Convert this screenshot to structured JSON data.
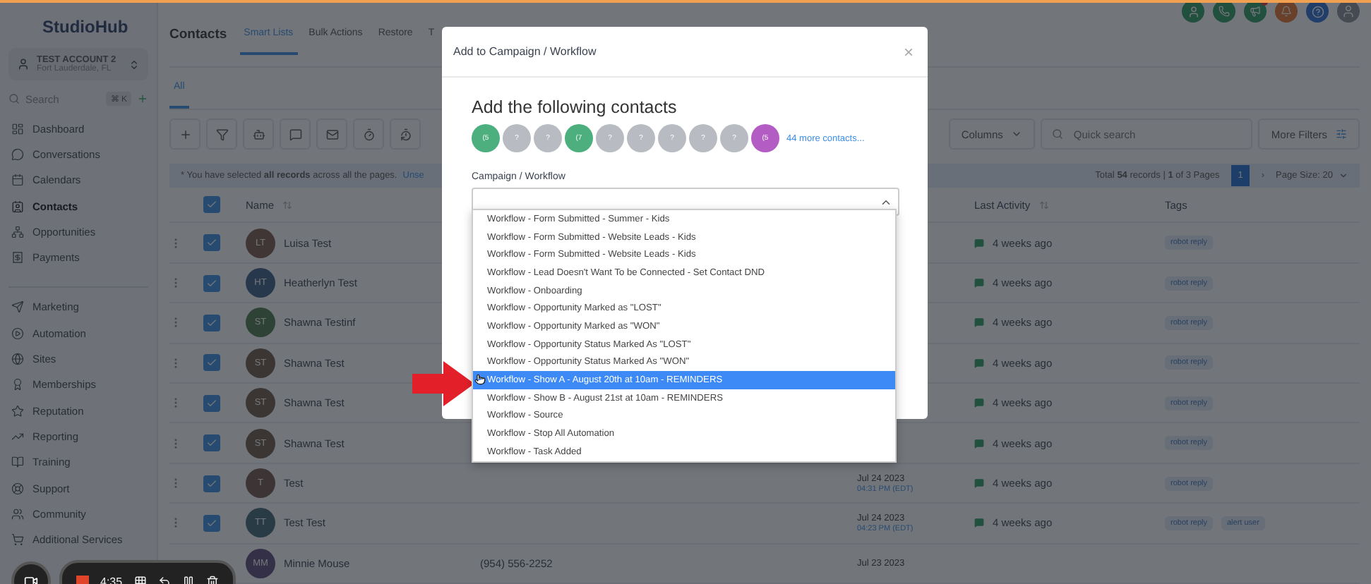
{
  "sidebar": {
    "logo": "StudioHub",
    "account": {
      "name": "TEST ACCOUNT 2",
      "location": "Fort Lauderdale, FL"
    },
    "search": {
      "placeholder": "Search",
      "shortcut": "⌘ K"
    },
    "nav_groups": [
      {
        "items": [
          {
            "label": "Dashboard",
            "selected": false
          },
          {
            "label": "Conversations",
            "selected": false
          },
          {
            "label": "Calendars",
            "selected": false
          },
          {
            "label": "Contacts",
            "selected": true
          },
          {
            "label": "Opportunities",
            "selected": false
          },
          {
            "label": "Payments",
            "selected": false
          }
        ]
      },
      {
        "items": [
          {
            "label": "Marketing",
            "selected": false
          },
          {
            "label": "Automation",
            "selected": false
          },
          {
            "label": "Sites",
            "selected": false
          },
          {
            "label": "Memberships",
            "selected": false
          },
          {
            "label": "Reputation",
            "selected": false
          },
          {
            "label": "Reporting",
            "selected": false
          },
          {
            "label": "Training",
            "selected": false
          },
          {
            "label": "Support",
            "selected": false
          },
          {
            "label": "Community",
            "selected": false
          },
          {
            "label": "Additional Services",
            "selected": false
          }
        ]
      }
    ]
  },
  "header": {
    "title": "Contacts",
    "tabs": [
      {
        "label": "Smart Lists",
        "selected": true
      },
      {
        "label": "Bulk Actions",
        "selected": false
      },
      {
        "label": "Restore",
        "selected": false
      },
      {
        "label": "T",
        "selected": false
      }
    ]
  },
  "subtabs": [
    {
      "label": "All",
      "selected": true
    }
  ],
  "toolbar": {
    "columns_button": "Columns",
    "search": {
      "placeholder": "Quick search"
    },
    "more_filters": "More Filters"
  },
  "banner": {
    "text": "* You have selected **all records** across all the pages.",
    "link": "Unse"
  },
  "pagination": {
    "summary": "Total **54** records | **1** of 3 Pages",
    "pages": [
      {
        "label": "1",
        "selected": true
      }
    ],
    "next": "›",
    "page_size": "Page Size: 20"
  },
  "table": {
    "all_checked": true,
    "columns": [
      "Name",
      "Last Activity",
      "Tags"
    ],
    "rows": [
      {
        "initials": "LT",
        "name": "Luisa Test",
        "checked": true,
        "last_activity": "4 weeks ago",
        "tags": [
          "robot reply"
        ]
      },
      {
        "initials": "HT",
        "name": "Heatherlyn Test",
        "checked": true,
        "last_activity": "4 weeks ago",
        "tags": [
          "robot reply"
        ]
      },
      {
        "initials": "ST",
        "name": "Shawna Testinf",
        "checked": true,
        "last_activity": "4 weeks ago",
        "tags": [
          "robot reply"
        ]
      },
      {
        "initials": "ST",
        "name": "Shawna Test",
        "checked": true,
        "last_activity": "4 weeks ago",
        "tags": [
          "robot reply"
        ]
      },
      {
        "initials": "ST",
        "name": "Shawna Test",
        "checked": true,
        "last_activity": "4 weeks ago",
        "tags": [
          "robot reply"
        ]
      },
      {
        "initials": "ST",
        "name": "Shawna Test",
        "checked": true,
        "last_activity": "4 weeks ago",
        "tags": [
          "robot reply"
        ]
      },
      {
        "initials": "T",
        "name": "Test",
        "checked": true,
        "date": "Jul 24 2023",
        "time": "04:31 PM (EDT)",
        "last_activity": "4 weeks ago",
        "tags": [
          "robot reply"
        ]
      },
      {
        "initials": "TT",
        "name": "Test Test",
        "checked": true,
        "date": "Jul 24 2023",
        "time": "04:23 PM (EDT)",
        "last_activity": "4 weeks ago",
        "tags": [
          "robot reply",
          "alert user"
        ]
      },
      {
        "initials": "MM",
        "name": "Minnie Mouse",
        "phone": "(954) 556-2252",
        "date": "Jul 23 2023"
      }
    ]
  },
  "modal": {
    "title": "Add to Campaign / Workflow",
    "close": "×",
    "heading": "Add the following contacts",
    "contacts": [
      {
        "text": "(5",
        "color": "#4caf7d"
      },
      {
        "text": "?",
        "color": "#b8bcc2"
      },
      {
        "text": "?",
        "color": "#b8bcc2"
      },
      {
        "text": "(7",
        "color": "#4caf7d"
      },
      {
        "text": "?",
        "color": "#b8bcc2"
      },
      {
        "text": "?",
        "color": "#b8bcc2"
      },
      {
        "text": "?",
        "color": "#b8bcc2"
      },
      {
        "text": "?",
        "color": "#b8bcc2"
      },
      {
        "text": "?",
        "color": "#b8bcc2"
      },
      {
        "text": "(5",
        "color": "#b35cc4"
      }
    ],
    "more_link": "44 more contacts...",
    "field_label": "Campaign / Workflow",
    "expanded": true,
    "options": [
      {
        "label": "Workflow - Form Submitted - Summer - Kids",
        "selected": false
      },
      {
        "label": "Workflow - Form Submitted - Website Leads - Kids",
        "selected": false
      },
      {
        "label": "Workflow - Form Submitted - Website Leads - Kids",
        "selected": false
      },
      {
        "label": "Workflow - Lead Doesn't Want To be Connected - Set Contact DND",
        "selected": false
      },
      {
        "label": "Workflow - Onboarding",
        "selected": false
      },
      {
        "label": "Workflow - Opportunity Marked as \"LOST\"",
        "selected": false
      },
      {
        "label": "Workflow - Opportunity Marked as \"WON\"",
        "selected": false
      },
      {
        "label": "Workflow - Opportunity Status Marked As \"LOST\"",
        "selected": false
      },
      {
        "label": "Workflow - Opportunity Status Marked As \"WON\"",
        "selected": false
      },
      {
        "label": "Workflow - Show A - August 20th at 10am - REMINDERS",
        "selected": true
      },
      {
        "label": "Workflow - Show B - August 21st at 10am - REMINDERS",
        "selected": false
      },
      {
        "label": "Workflow - Source",
        "selected": false
      },
      {
        "label": "Workflow - Stop All Automation",
        "selected": false
      },
      {
        "label": "Workflow - Task Added",
        "selected": false
      }
    ]
  },
  "recorder": {
    "time": "4:35"
  }
}
